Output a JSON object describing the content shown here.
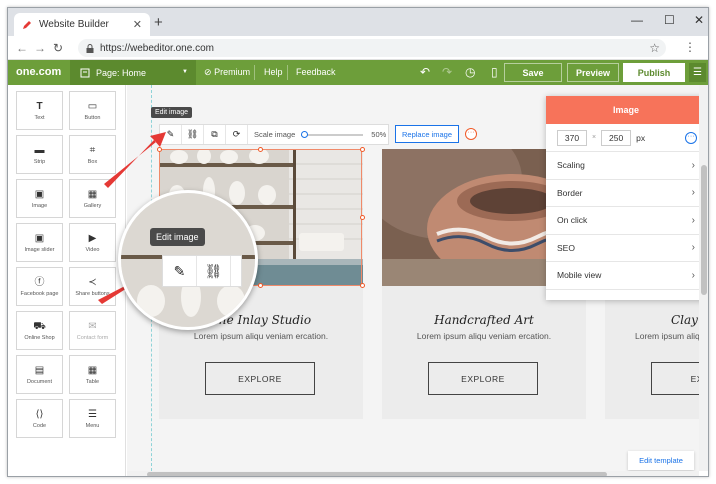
{
  "browser": {
    "tab_title": "Website Builder",
    "new_tab": "+",
    "close_tab": "✕",
    "url": "https://webeditor.one.com",
    "minimize": "—",
    "maximize": "☐",
    "close_window": "✕"
  },
  "toolbar": {
    "logo": "one.com",
    "page_selector": "Page: Home",
    "premium": "Premium",
    "help": "Help",
    "feedback": "Feedback",
    "save": "Save",
    "preview": "Preview",
    "publish": "Publish",
    "accent_color": "#6d9e3a"
  },
  "widgets": [
    {
      "label": "Text",
      "icon": "T"
    },
    {
      "label": "Button",
      "icon": "▭"
    },
    {
      "label": "Strip",
      "icon": "▬"
    },
    {
      "label": "Box",
      "icon": "⌗"
    },
    {
      "label": "Image",
      "icon": "▣"
    },
    {
      "label": "Gallery",
      "icon": "▦"
    },
    {
      "label": "Image slider",
      "icon": "▣"
    },
    {
      "label": "Video",
      "icon": "▶"
    },
    {
      "label": "Facebook page",
      "icon": "ⓕ"
    },
    {
      "label": "Share buttons",
      "icon": "≺"
    },
    {
      "label": "Online Shop",
      "icon": "⛟"
    },
    {
      "label": "Contact form",
      "icon": "✉"
    },
    {
      "label": "Document",
      "icon": "▤"
    },
    {
      "label": "Table",
      "icon": "▦"
    },
    {
      "label": "Code",
      "icon": "⟨⟩"
    },
    {
      "label": "Menu",
      "icon": "☰"
    }
  ],
  "image_toolbar": {
    "tooltip": "Edit image",
    "scale_label": "Scale image",
    "scale_value": "50%",
    "scale_fraction": 0.0,
    "replace": "Replace image"
  },
  "zoom_callout": {
    "tooltip": "Edit image"
  },
  "cards": [
    {
      "title": "The Inlay Studio",
      "desc": "Lorem ipsum aliqu veniam ercation.",
      "button": "EXPLORE"
    },
    {
      "title": "Handcrafted Art",
      "desc": "Lorem ipsum aliqu veniam ercation.",
      "button": "EXPLORE"
    },
    {
      "title": "Clay L",
      "desc": "Lorem ipsum aliqu veniam ercation.",
      "button": "EXPLO"
    }
  ],
  "image_panel": {
    "title": "Image",
    "width": "370",
    "height": "250",
    "x_sep": "×",
    "unit": "px",
    "rows": [
      "Scaling",
      "Border",
      "On click",
      "SEO",
      "Mobile view"
    ],
    "header_color": "#f7735a"
  },
  "edit_template": "Edit template"
}
